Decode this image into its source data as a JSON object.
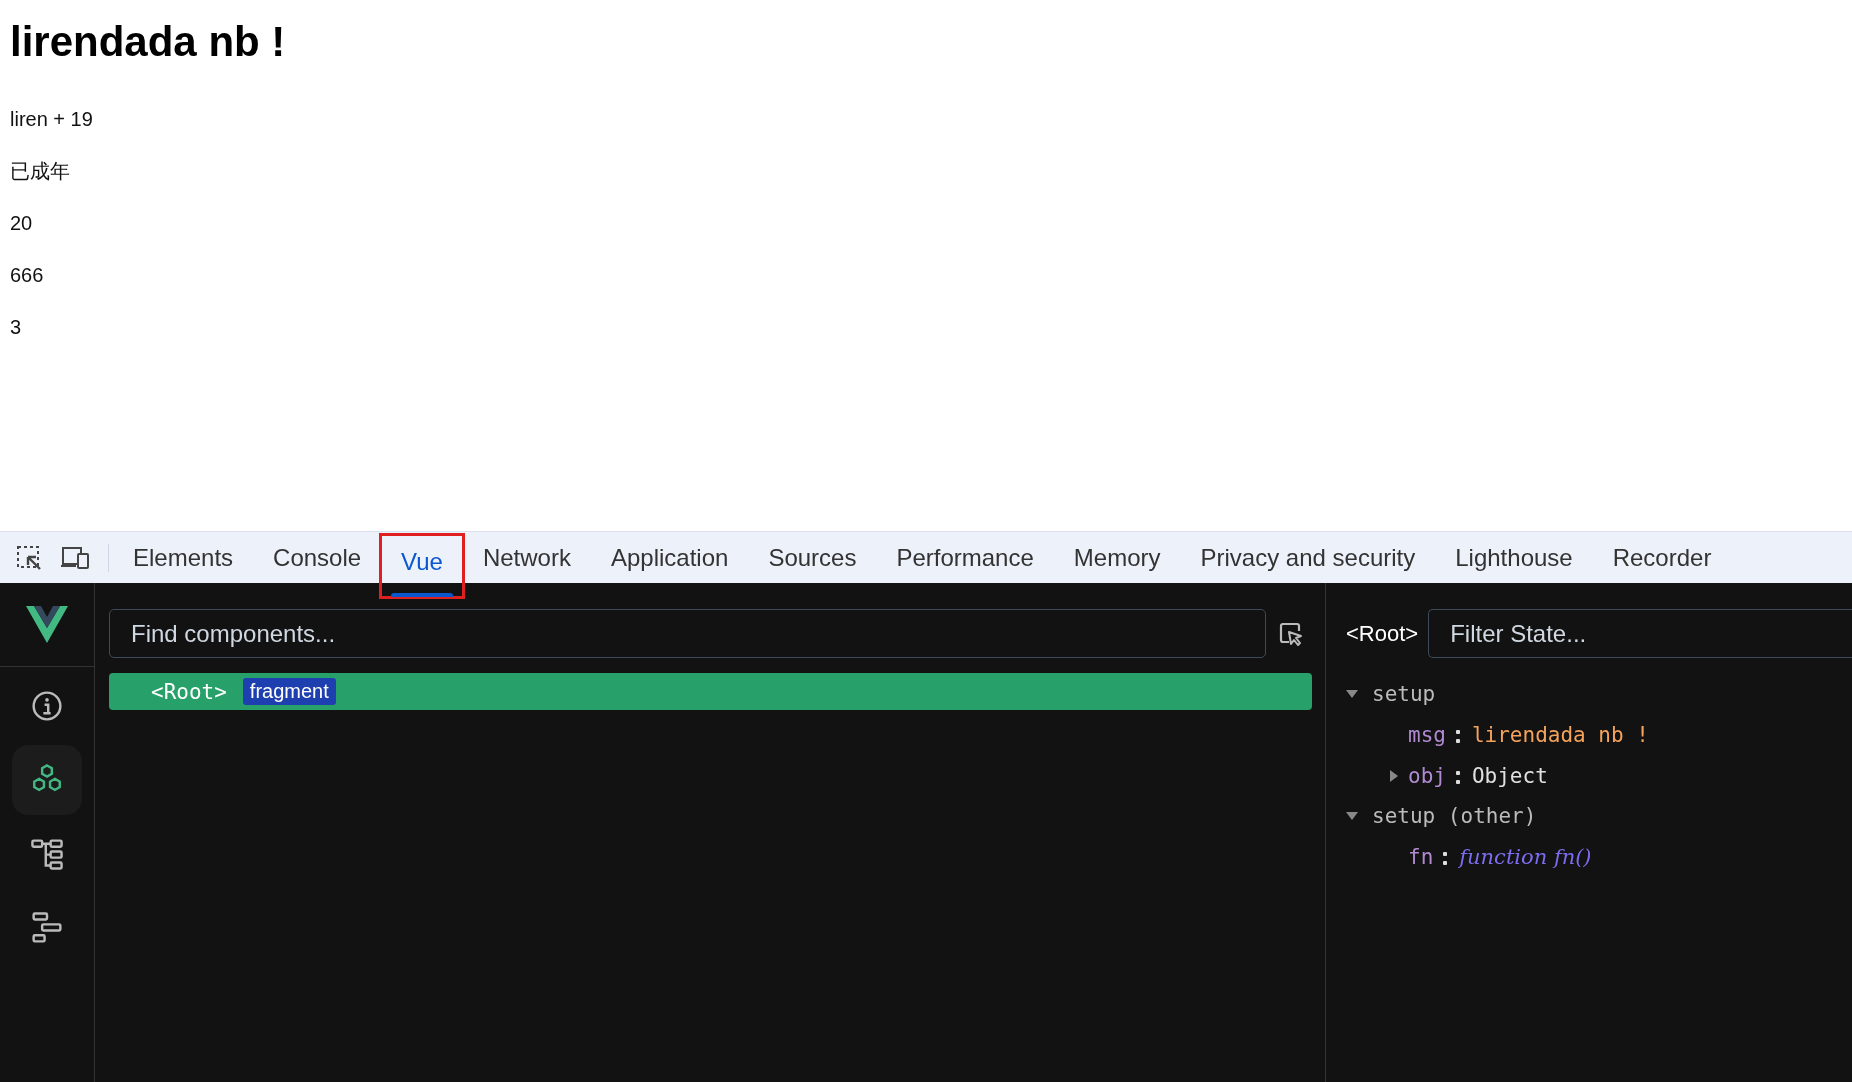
{
  "page": {
    "heading": "lirendada nb !",
    "paragraphs": [
      "liren + 19",
      "已成年",
      "20",
      "666",
      "3"
    ]
  },
  "devtools": {
    "tabs": [
      {
        "label": "Elements",
        "selected": false,
        "annotated": false
      },
      {
        "label": "Console",
        "selected": false,
        "annotated": false
      },
      {
        "label": "Vue",
        "selected": true,
        "annotated": true
      },
      {
        "label": "Network",
        "selected": false,
        "annotated": false
      },
      {
        "label": "Application",
        "selected": false,
        "annotated": false
      },
      {
        "label": "Sources",
        "selected": false,
        "annotated": false
      },
      {
        "label": "Performance",
        "selected": false,
        "annotated": false
      },
      {
        "label": "Memory",
        "selected": false,
        "annotated": false
      },
      {
        "label": "Privacy and security",
        "selected": false,
        "annotated": false
      },
      {
        "label": "Lighthouse",
        "selected": false,
        "annotated": false
      },
      {
        "label": "Recorder",
        "selected": false,
        "annotated": false
      }
    ]
  },
  "vue_panel": {
    "nav": [
      {
        "kind": "info",
        "selected": false
      },
      {
        "kind": "components",
        "selected": true
      },
      {
        "kind": "tree",
        "selected": false
      },
      {
        "kind": "timeline",
        "selected": false
      }
    ],
    "component_search": {
      "placeholder": "Find components..."
    },
    "component_tree": [
      {
        "label": "<Root>",
        "badge": "fragment",
        "selected": true
      }
    ],
    "inspector": {
      "component": "<Root>",
      "filter": {
        "placeholder": "Filter State..."
      },
      "sections": [
        {
          "title": "setup",
          "expanded": true,
          "children": [
            {
              "key": "msg",
              "kind": "string",
              "value": "lirendada nb !"
            },
            {
              "key": "obj",
              "kind": "object",
              "value": "Object",
              "expanded": false
            }
          ]
        },
        {
          "title": "setup (other)",
          "expanded": true,
          "children": [
            {
              "key": "fn",
              "kind": "function",
              "value": "function fn()"
            }
          ]
        }
      ]
    }
  }
}
